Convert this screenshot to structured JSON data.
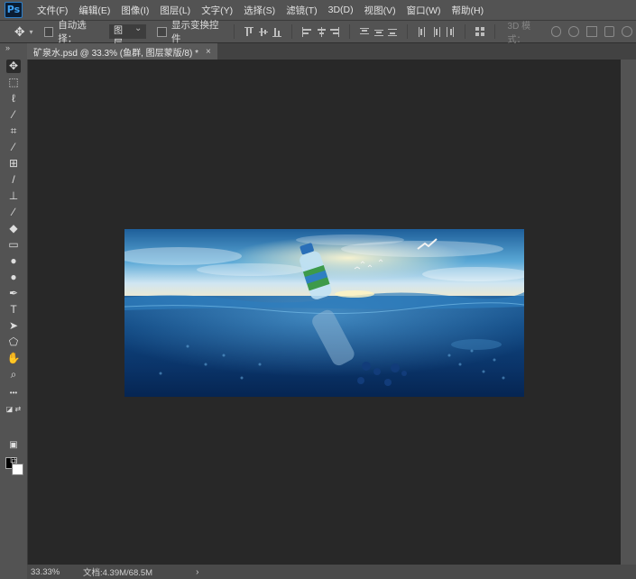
{
  "app": {
    "logo": "Ps"
  },
  "menu": {
    "items": [
      "文件(F)",
      "编辑(E)",
      "图像(I)",
      "图层(L)",
      "文字(Y)",
      "选择(S)",
      "滤镜(T)",
      "3D(D)",
      "视图(V)",
      "窗口(W)",
      "帮助(H)"
    ]
  },
  "options": {
    "auto_select_label": "自动选择：",
    "auto_select_value": "图层",
    "show_transform_label": "显示变换控件",
    "mode_3d_label": "3D 模式："
  },
  "document": {
    "tab_title": "矿泉水.psd @ 33.3% (鱼群, 图层蒙版/8) *",
    "close_glyph": "×"
  },
  "status": {
    "zoom": "33.33%",
    "doc_info": "文档:4.39M/68.5M",
    "arrow": "›"
  },
  "toolbar": {
    "collapse": "»",
    "tools": [
      {
        "name": "move-tool-icon",
        "glyph": "✥",
        "selected": true
      },
      {
        "name": "marquee-tool-icon",
        "glyph": "⬚"
      },
      {
        "name": "lasso-tool-icon",
        "glyph": "ℓ"
      },
      {
        "name": "magic-wand-tool-icon",
        "glyph": "⁄"
      },
      {
        "name": "crop-tool-icon",
        "glyph": "⌗"
      },
      {
        "name": "eyedropper-tool-icon",
        "glyph": "⁄"
      },
      {
        "name": "healing-brush-tool-icon",
        "glyph": "⊞"
      },
      {
        "name": "brush-tool-icon",
        "glyph": "/"
      },
      {
        "name": "clone-stamp-tool-icon",
        "glyph": "⊥"
      },
      {
        "name": "history-brush-tool-icon",
        "glyph": "∕"
      },
      {
        "name": "eraser-tool-icon",
        "glyph": "◆"
      },
      {
        "name": "gradient-tool-icon",
        "glyph": "▭"
      },
      {
        "name": "blur-tool-icon",
        "glyph": "●"
      },
      {
        "name": "dodge-tool-icon",
        "glyph": "●"
      },
      {
        "name": "pen-tool-icon",
        "glyph": "✒"
      },
      {
        "name": "type-tool-icon",
        "glyph": "T"
      },
      {
        "name": "path-selection-tool-icon",
        "glyph": "➤"
      },
      {
        "name": "shape-tool-icon",
        "glyph": "⬠"
      },
      {
        "name": "hand-tool-icon",
        "glyph": "✋"
      },
      {
        "name": "zoom-tool-icon",
        "glyph": "⌕"
      },
      {
        "name": "more-tools-icon",
        "glyph": "•••"
      }
    ]
  },
  "colors": {
    "foreground": "#000000",
    "background": "#ffffff",
    "workspace": "#282828",
    "ui": "#535353"
  }
}
